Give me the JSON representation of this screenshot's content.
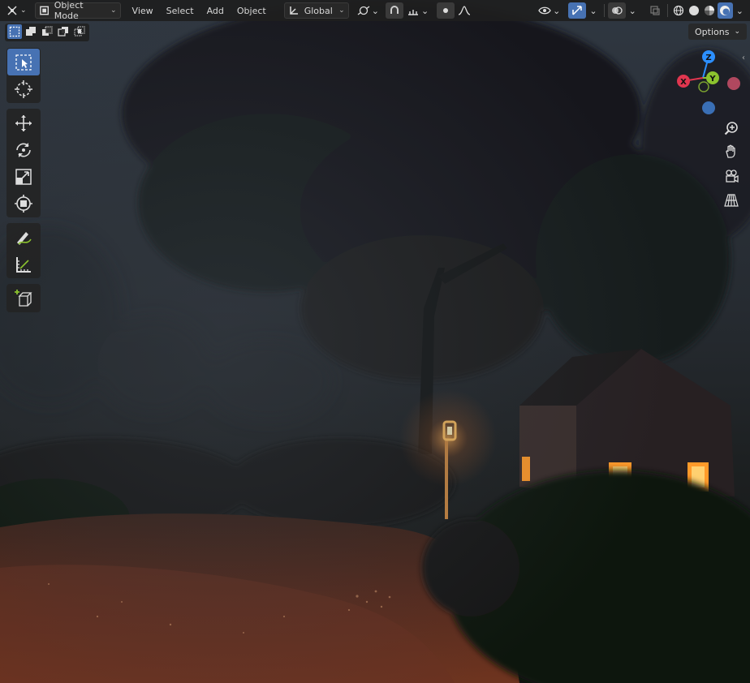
{
  "header": {
    "mode_label": "Object Mode",
    "menu": [
      "View",
      "Select",
      "Add",
      "Object"
    ],
    "orientation_label": "Global"
  },
  "options_label": "Options",
  "gizmo": {
    "x_label": "X",
    "y_label": "Y",
    "z_label": "Z",
    "colors": {
      "x": "#e0364f",
      "y": "#8bc22e",
      "z": "#2c8fff"
    }
  },
  "icons": {
    "header": [
      "editor-type-icon",
      "object-mode-icon",
      "transform-orientation-icon",
      "pivot-icon",
      "snap-icon",
      "snap-increment-icon",
      "proportional-editing-icon",
      "falloff-icon",
      "visibility-icon",
      "gizmo-icon",
      "overlays-icon",
      "xray-icon",
      "wireframe-shading-icon",
      "solid-shading-icon",
      "material-shading-icon",
      "rendered-shading-icon"
    ],
    "toolbar": [
      "select-box-icon",
      "cursor-icon",
      "move-icon",
      "rotate-icon",
      "scale-icon",
      "transform-icon",
      "annotate-icon",
      "measure-icon",
      "add-cube-icon"
    ],
    "nav": [
      "zoom-icon",
      "hand-pan-icon",
      "camera-view-icon",
      "grid-perspective-icon"
    ]
  }
}
